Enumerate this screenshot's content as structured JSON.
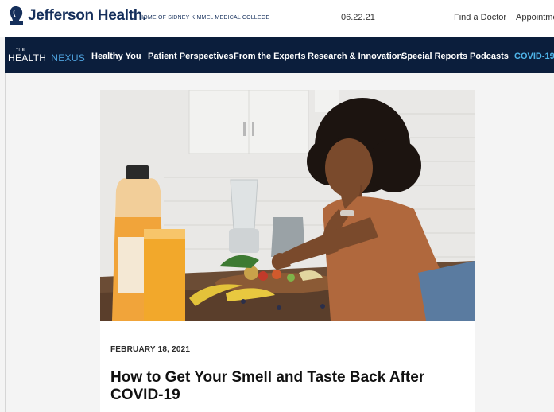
{
  "header": {
    "logo_text": "Jefferson Health.",
    "tagline": "HOME OF SIDNEY KIMMEL MEDICAL COLLEGE",
    "date": "06.22.21",
    "links": [
      "Find a Doctor",
      "Appointme"
    ]
  },
  "nav": {
    "brand_small": "THE",
    "brand_word1": "HEALTH",
    "brand_word2": "NEXUS",
    "items": [
      "Healthy You",
      "Patient Perspectives",
      "From the Experts",
      "Research & Innovation",
      "Special Reports",
      "Podcasts",
      "COVID-19"
    ]
  },
  "article": {
    "date": "FEBRUARY 18, 2021",
    "title": "How to Get Your Smell and Taste Back After COVID-19"
  },
  "colors": {
    "brand_navy": "#152f5b",
    "nav_bg": "#0b1e3c",
    "covid_link": "#4fb5ea"
  },
  "icons": {
    "logo": "jefferson-logo-icon"
  }
}
